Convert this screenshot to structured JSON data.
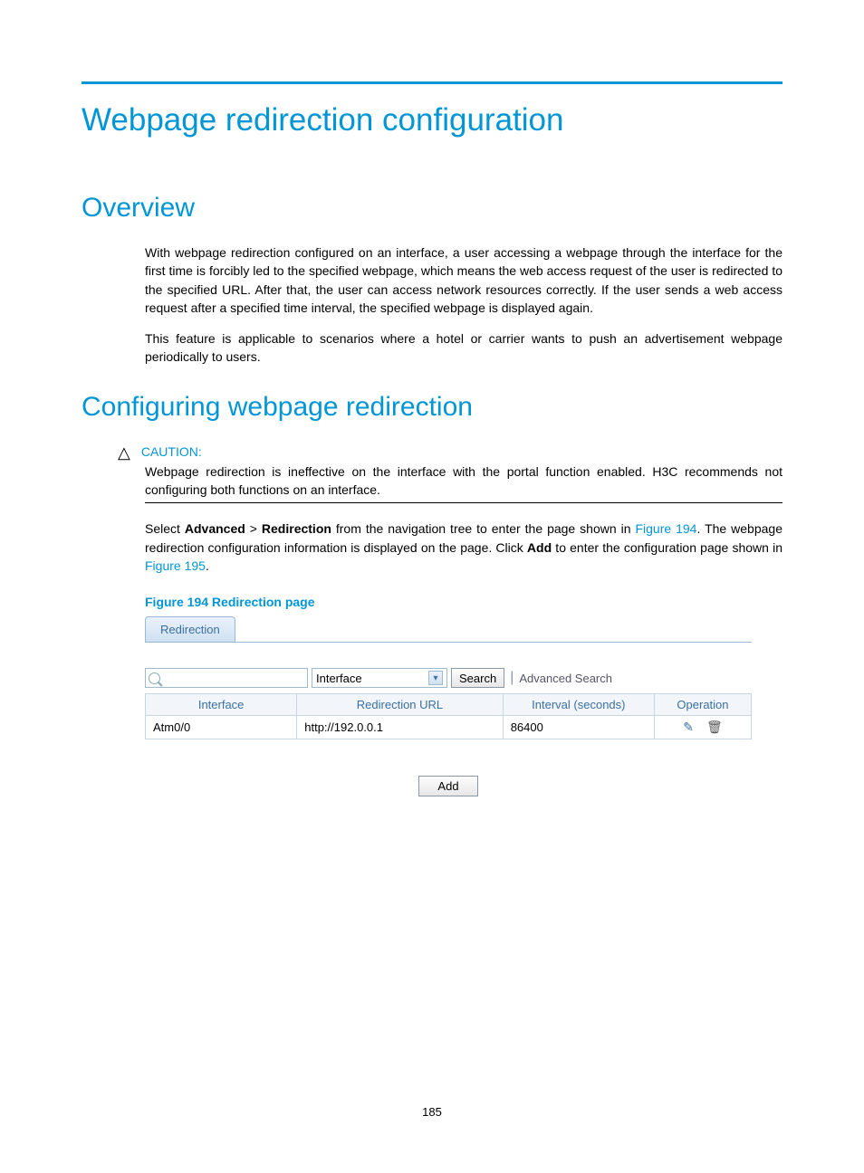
{
  "title": "Webpage redirection configuration",
  "overview": {
    "heading": "Overview",
    "para1": "With webpage redirection configured on an interface, a user accessing a webpage through the interface for the first time is forcibly led to the specified webpage, which means the web access request of the user is redirected to the specified URL. After that, the user can access network resources correctly. If the user sends a web access request after a specified time interval, the specified webpage is displayed again.",
    "para2": "This feature is applicable to scenarios where a hotel or carrier wants to push an advertisement webpage periodically to users."
  },
  "configuring": {
    "heading": "Configuring webpage redirection",
    "caution_label": "CAUTION:",
    "caution_text": "Webpage redirection is ineffective on the interface with the portal function enabled. H3C recommends not configuring both functions on an interface.",
    "para_pre": "Select ",
    "nav1": "Advanced",
    "gt": " > ",
    "nav2": "Redirection",
    "para_mid1": " from the navigation tree to enter the page shown in ",
    "fig194": "Figure 194",
    "para_mid2": ". The webpage redirection configuration information is displayed on the page. Click ",
    "add_bold": "Add",
    "para_mid3": " to enter the configuration page shown in ",
    "fig195": "Figure 195",
    "para_end": "."
  },
  "figure_caption": "Figure 194 Redirection page",
  "screenshot": {
    "tab": "Redirection",
    "dropdown_value": "Interface",
    "search_button": "Search",
    "advanced_search": "Advanced Search",
    "headers": {
      "interface": "Interface",
      "url": "Redirection URL",
      "interval": "Interval (seconds)",
      "operation": "Operation"
    },
    "row": {
      "interface": "Atm0/0",
      "url": "http://192.0.0.1",
      "interval": "86400"
    },
    "add_button": "Add"
  },
  "page_number": "185"
}
